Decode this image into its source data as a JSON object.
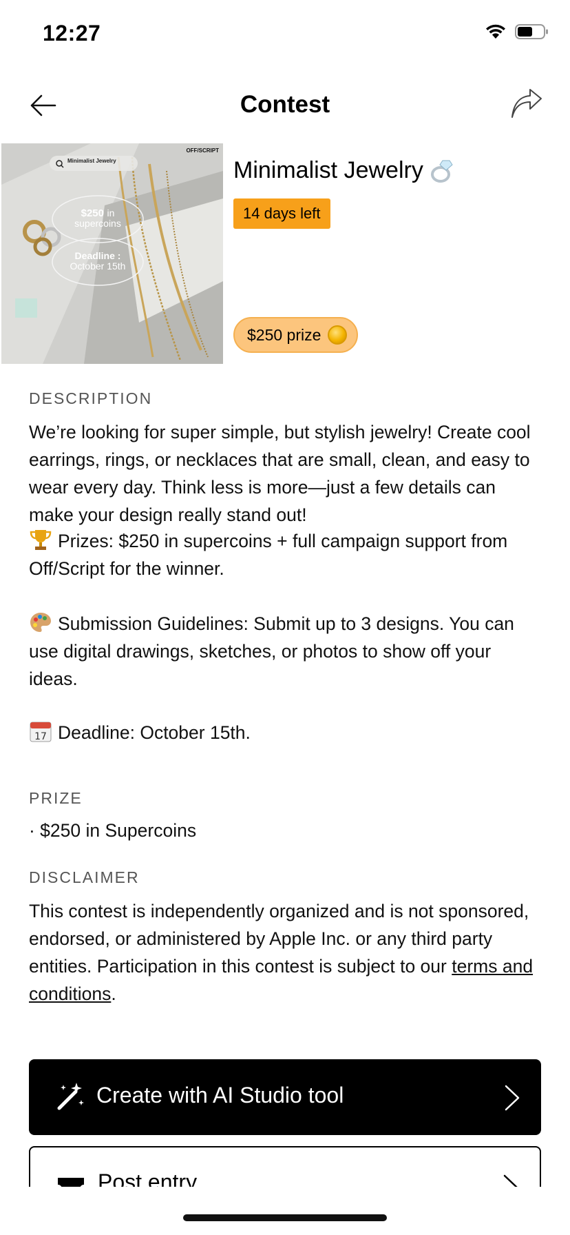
{
  "status_bar": {
    "time": "12:27"
  },
  "nav": {
    "title": "Contest"
  },
  "contest": {
    "title": "Minimalist Jewelry",
    "days_left": "14 days left",
    "prize_pill": "$250 prize"
  },
  "hero_image": {
    "brand": "OFF/SCRIPT",
    "search_text": "Minimalist Jewelry",
    "prize_big": "$250",
    "prize_in": "in",
    "prize_sub": "supercoins",
    "deadline_label": "Deadline :",
    "deadline_date": "October 15th"
  },
  "sections": {
    "description_label": "DESCRIPTION",
    "description_paragraph": "We’re looking for super simple, but stylish jewelry! Create cool earrings, rings, or necklaces that are small, clean, and easy to wear every day. Think less is more—just a few details can make your design really stand out!",
    "prizes_text": "Prizes: $250 in supercoins + full campaign support from Off/Script for the winner.",
    "guidelines_text": "Submission Guidelines: Submit up to 3 designs. You can use digital drawings, sketches, or photos to show off your ideas.",
    "deadline_text": "Deadline: October 15th.",
    "prize_label": "PRIZE",
    "prize_item": "· $250 in Supercoins",
    "disclaimer_label": "DISCLAIMER",
    "disclaimer_text": "This contest is independently organized and is not sponsored, endorsed, or administered by Apple Inc. or any third party entities. Participation in this contest is subject to our ",
    "terms_link": "terms and conditions",
    "disclaimer_end": "."
  },
  "actions": {
    "ai_studio_label": "Create with AI Studio tool",
    "post_entry_label": "Post entry"
  },
  "icons": {
    "back": "arrow-left-icon",
    "share": "share-arrow-icon",
    "ring": "ring-emoji",
    "coin": "coin-icon",
    "trophy": "trophy-emoji",
    "palette": "palette-emoji",
    "calendar": "calendar-emoji",
    "magic": "magic-wand-icon",
    "ticket": "ticket-icon",
    "chevron": "chevron-right-icon"
  },
  "colors": {
    "badge_orange": "#f7a01a",
    "prize_pill_bg": "#fcc57d",
    "button_primary": "#000000"
  }
}
